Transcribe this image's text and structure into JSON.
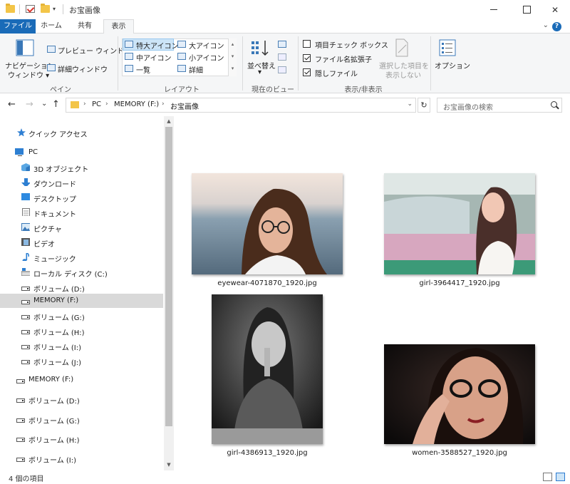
{
  "window": {
    "title": "お宝画像",
    "minimize_icon": "minimize-icon",
    "maximize_icon": "maximize-icon",
    "close_glyph": "✕"
  },
  "tabs": {
    "file": "ファイル",
    "home": "ホーム",
    "share": "共有",
    "view": "表示",
    "help_glyph": "?",
    "collapse_glyph": "⌄"
  },
  "ribbon": {
    "pane_group": {
      "label": "ペイン",
      "nav_window": "ナビゲーション",
      "nav_window2": "ウィンドウ ▾",
      "preview_window": "プレビュー ウィンドウ",
      "details_window": "詳細ウィンドウ"
    },
    "layout_group": {
      "label": "レイアウト",
      "extra_large": "特大アイコン",
      "large": "大アイコン",
      "medium": "中アイコン",
      "small": "小アイコン",
      "list": "一覧",
      "details": "詳細"
    },
    "current_view_group": {
      "label": "現在のビュー",
      "sort": "並べ替え",
      "sort2": "▾"
    },
    "show_hide_group": {
      "label": "表示/非表示",
      "item_checkboxes": "項目チェック ボックス",
      "item_checkboxes_checked": false,
      "file_extensions": "ファイル名拡張子",
      "file_extensions_checked": true,
      "hidden_items": "隠しファイル",
      "hidden_items_checked": true,
      "hide_selected": "選択した項目を",
      "hide_selected2": "表示しない"
    },
    "options": "オプション"
  },
  "address": {
    "back_glyph": "←",
    "forward_glyph": "→",
    "recent_glyph": "⌄",
    "up_glyph": "↑",
    "crumbs": [
      "PC",
      "MEMORY (F:)",
      "お宝画像"
    ],
    "sep": "›",
    "dropdown_glyph": "⌄",
    "refresh_glyph": "↻",
    "search_placeholder": "お宝画像の検索"
  },
  "nav": {
    "items": [
      {
        "label": "クイック アクセス",
        "icon": "star-icon"
      },
      {
        "label": "PC",
        "icon": "pc-icon"
      },
      {
        "label": "3D オブジェクト",
        "icon": "3d-objects-icon"
      },
      {
        "label": "ダウンロード",
        "icon": "download-icon"
      },
      {
        "label": "デスクトップ",
        "icon": "desktop-icon"
      },
      {
        "label": "ドキュメント",
        "icon": "document-icon"
      },
      {
        "label": "ピクチャ",
        "icon": "pictures-icon"
      },
      {
        "label": "ビデオ",
        "icon": "video-icon"
      },
      {
        "label": "ミュージック",
        "icon": "music-icon"
      },
      {
        "label": "ローカル ディスク (C:)",
        "icon": "local-disk-icon"
      },
      {
        "label": "ボリューム (D:)",
        "icon": "drive-icon"
      },
      {
        "label": "MEMORY (F:)",
        "icon": "drive-icon"
      },
      {
        "label": "ボリューム (G:)",
        "icon": "drive-icon"
      },
      {
        "label": "ボリューム (H:)",
        "icon": "drive-icon"
      },
      {
        "label": "ボリューム (I:)",
        "icon": "drive-icon"
      },
      {
        "label": "ボリューム (J:)",
        "icon": "drive-icon"
      },
      {
        "label": "MEMORY (F:)",
        "icon": "drive-icon"
      },
      {
        "label": "ボリューム (D:)",
        "icon": "drive-icon"
      },
      {
        "label": "ボリューム (G:)",
        "icon": "drive-icon"
      },
      {
        "label": "ボリューム (H:)",
        "icon": "drive-icon"
      },
      {
        "label": "ボリューム (I:)",
        "icon": "drive-icon"
      }
    ]
  },
  "files": [
    {
      "name": "eyewear-4071870_1920.jpg"
    },
    {
      "name": "girl-3964417_1920.jpg"
    },
    {
      "name": "girl-4386913_1920.jpg"
    },
    {
      "name": "women-3588527_1920.jpg"
    }
  ],
  "status": {
    "item_count": "4 個の項目"
  },
  "colors": {
    "accent": "#1a6bb8",
    "selection": "#cce4f7",
    "folder": "#f3c548"
  }
}
